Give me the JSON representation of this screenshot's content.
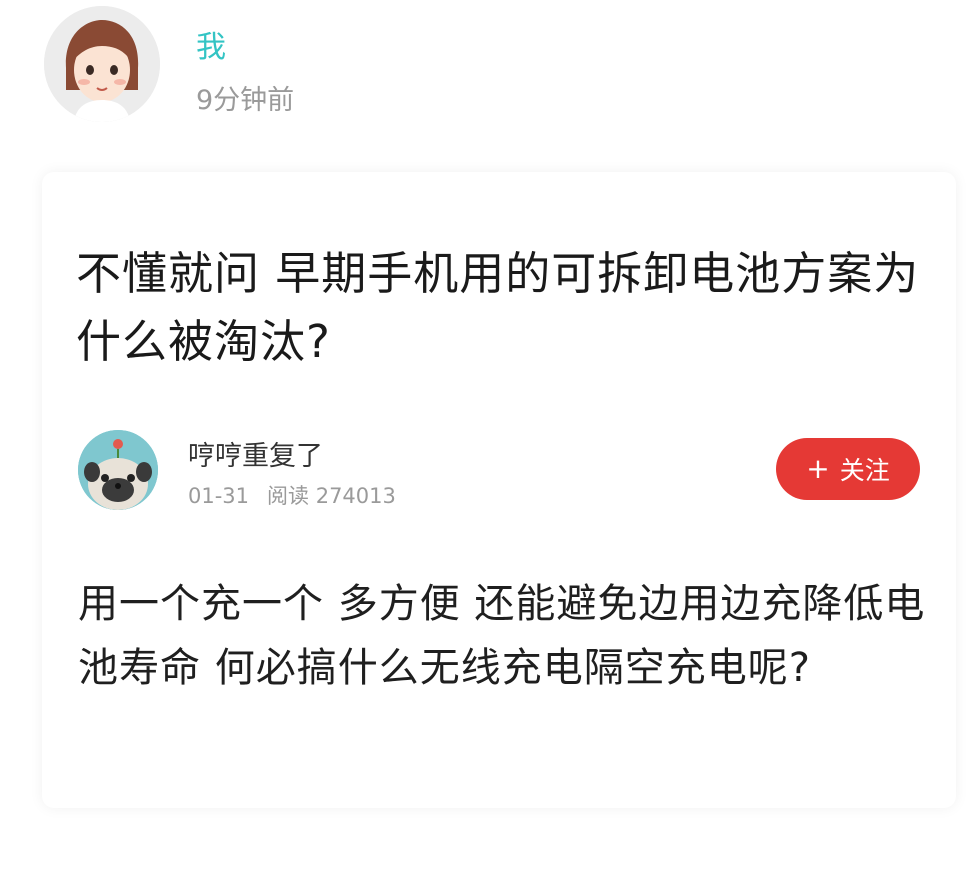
{
  "poster": {
    "name": "我",
    "time": "9分钟前"
  },
  "question": {
    "title": "不懂就问 早期手机用的可拆卸电池方案为什么被淘汰?"
  },
  "answer": {
    "author": {
      "name": "哼哼重复了",
      "date": "01-31",
      "reads_label": "阅读 274013"
    },
    "follow_button": {
      "icon": "+",
      "label": "关注"
    },
    "body": "用一个充一个 多方便 还能避免边用边充降低电池寿命 何必搞什么无线充电隔空充电呢?"
  },
  "colors": {
    "poster_name": "#33c4c4",
    "secondary_text": "#9a9a9a",
    "follow_button": "#e53935"
  }
}
